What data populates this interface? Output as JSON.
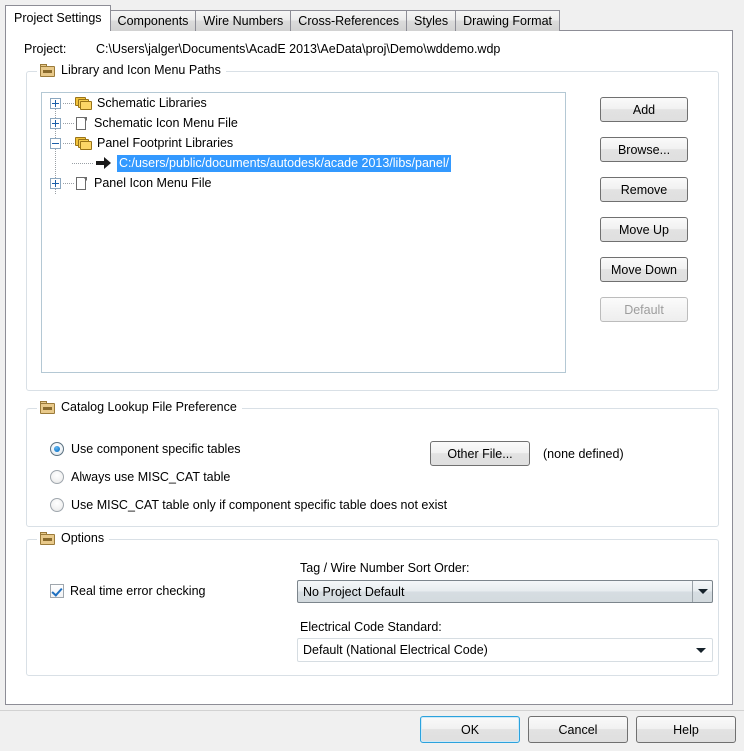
{
  "window": {
    "title": "Project Settings"
  },
  "tabs": [
    {
      "label": "Project Settings",
      "active": true
    },
    {
      "label": "Components",
      "active": false
    },
    {
      "label": "Wire Numbers",
      "active": false
    },
    {
      "label": "Cross-References",
      "active": false
    },
    {
      "label": "Styles",
      "active": false
    },
    {
      "label": "Drawing Format",
      "active": false
    }
  ],
  "project": {
    "label": "Project:",
    "path": "C:\\Users\\jalger\\Documents\\AcadE 2013\\AeData\\proj\\Demo\\wddemo.wdp"
  },
  "library_group": {
    "title": "Library and Icon Menu Paths",
    "tree": [
      {
        "label": "Schematic Libraries",
        "icon": "folder-stack-icon",
        "expander": "plus",
        "selected": false
      },
      {
        "label": "Schematic Icon Menu File",
        "icon": "page-icon",
        "expander": "plus",
        "selected": false
      },
      {
        "label": "Panel Footprint Libraries",
        "icon": "folder-stack-icon",
        "expander": "minus",
        "selected": false
      },
      {
        "label": "C:/users/public/documents/autodesk/acade 2013/libs/panel/",
        "icon": "arrow-icon",
        "expander": "none",
        "selected": true
      },
      {
        "label": "Panel Icon Menu File",
        "icon": "page-icon",
        "expander": "plus",
        "selected": false
      }
    ],
    "buttons": [
      {
        "label": "Add",
        "enabled": true
      },
      {
        "label": "Browse...",
        "enabled": true
      },
      {
        "label": "Remove",
        "enabled": true
      },
      {
        "label": "Move Up",
        "enabled": true
      },
      {
        "label": "Move Down",
        "enabled": true
      },
      {
        "label": "Default",
        "enabled": false
      }
    ]
  },
  "catalog_group": {
    "title": "Catalog Lookup File Preference",
    "radios": [
      {
        "label": "Use component specific tables",
        "checked": true
      },
      {
        "label": "Always use MISC_CAT table",
        "checked": false
      },
      {
        "label": "Use MISC_CAT table only if component specific table does not exist",
        "checked": false
      }
    ],
    "other_file_button": "Other File...",
    "other_file_status": "(none defined)"
  },
  "options_group": {
    "title": "Options",
    "realtime_checkbox": {
      "label": "Real time error checking",
      "checked": true
    },
    "sort_order": {
      "label": "Tag / Wire Number Sort Order:",
      "value": "No Project Default"
    },
    "code_standard": {
      "label": "Electrical Code Standard:",
      "value": "Default (National Electrical Code)"
    }
  },
  "footer": {
    "ok": "OK",
    "cancel": "Cancel",
    "help": "Help"
  },
  "colors": {
    "selection_blue": "#3399ff",
    "focus_blue": "#2ba2dd",
    "folder_yellow": "#fcd667"
  }
}
